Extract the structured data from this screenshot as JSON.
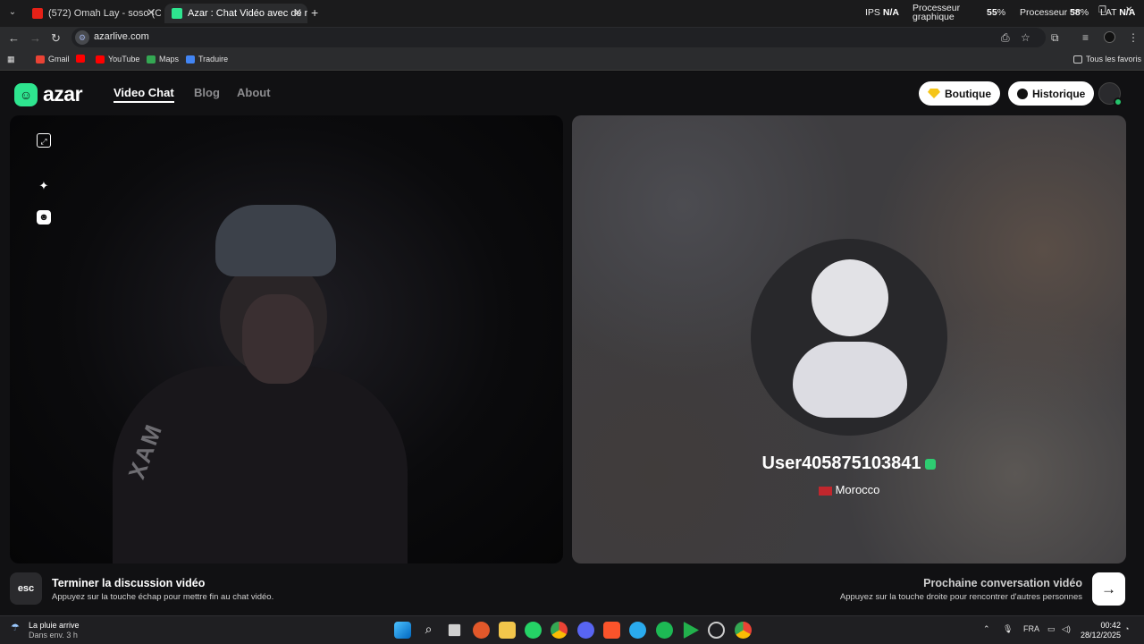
{
  "browser": {
    "tabs": [
      {
        "label": "(572) Omah Lay - soso (Offi",
        "favicon_color": "#e62117"
      },
      {
        "label": "Azar : Chat Vidéo avec de n",
        "favicon_color": "#2ee58f"
      }
    ],
    "hud": {
      "ips_label": "IPS",
      "ips_value": "N/A",
      "gpu_label_line1": "Processeur",
      "gpu_label_line2": "graphique",
      "gpu_value": "55",
      "cpu_label": "Processeur",
      "cpu_value": "58",
      "lat_label": "LAT",
      "lat_value": "N/A",
      "percent": "%"
    },
    "url": "azarlive.com",
    "bookmarks": [
      {
        "label": "Gmail",
        "color": "#ea4335"
      },
      {
        "label": "",
        "color": "#ff0000"
      },
      {
        "label": "YouTube",
        "color": "#ff0000"
      },
      {
        "label": "Maps",
        "color": "#34a853"
      },
      {
        "label": "Traduire",
        "color": "#4285f4"
      }
    ],
    "all_bookmarks": "Tous les favoris"
  },
  "app": {
    "logo_text": "azar",
    "nav": [
      {
        "label": "Video Chat",
        "active": true
      },
      {
        "label": "Blog",
        "active": false
      },
      {
        "label": "About",
        "active": false
      }
    ],
    "boutique": "Boutique",
    "historique": "Historique",
    "accent": "#2ee58f"
  },
  "partner": {
    "username": "User405875103841",
    "country": "Morocco"
  },
  "local_video": {
    "jersey_text": "XAM"
  },
  "footer": {
    "esc_key": "esc",
    "end_title": "Terminer la discussion vidéo",
    "end_sub": "Appuyez sur la touche échap pour mettre fin au chat vidéo.",
    "next_title": "Prochaine conversation vidéo",
    "next_sub": "Appuyez sur la touche droite pour rencontrer d'autres personnes",
    "next_arrow": "→"
  },
  "taskbar": {
    "weather_title": "La pluie arrive",
    "weather_sub": "Dans env. 3 h",
    "lang": "FRA",
    "time": "00:42",
    "date": "28/12/2025"
  }
}
